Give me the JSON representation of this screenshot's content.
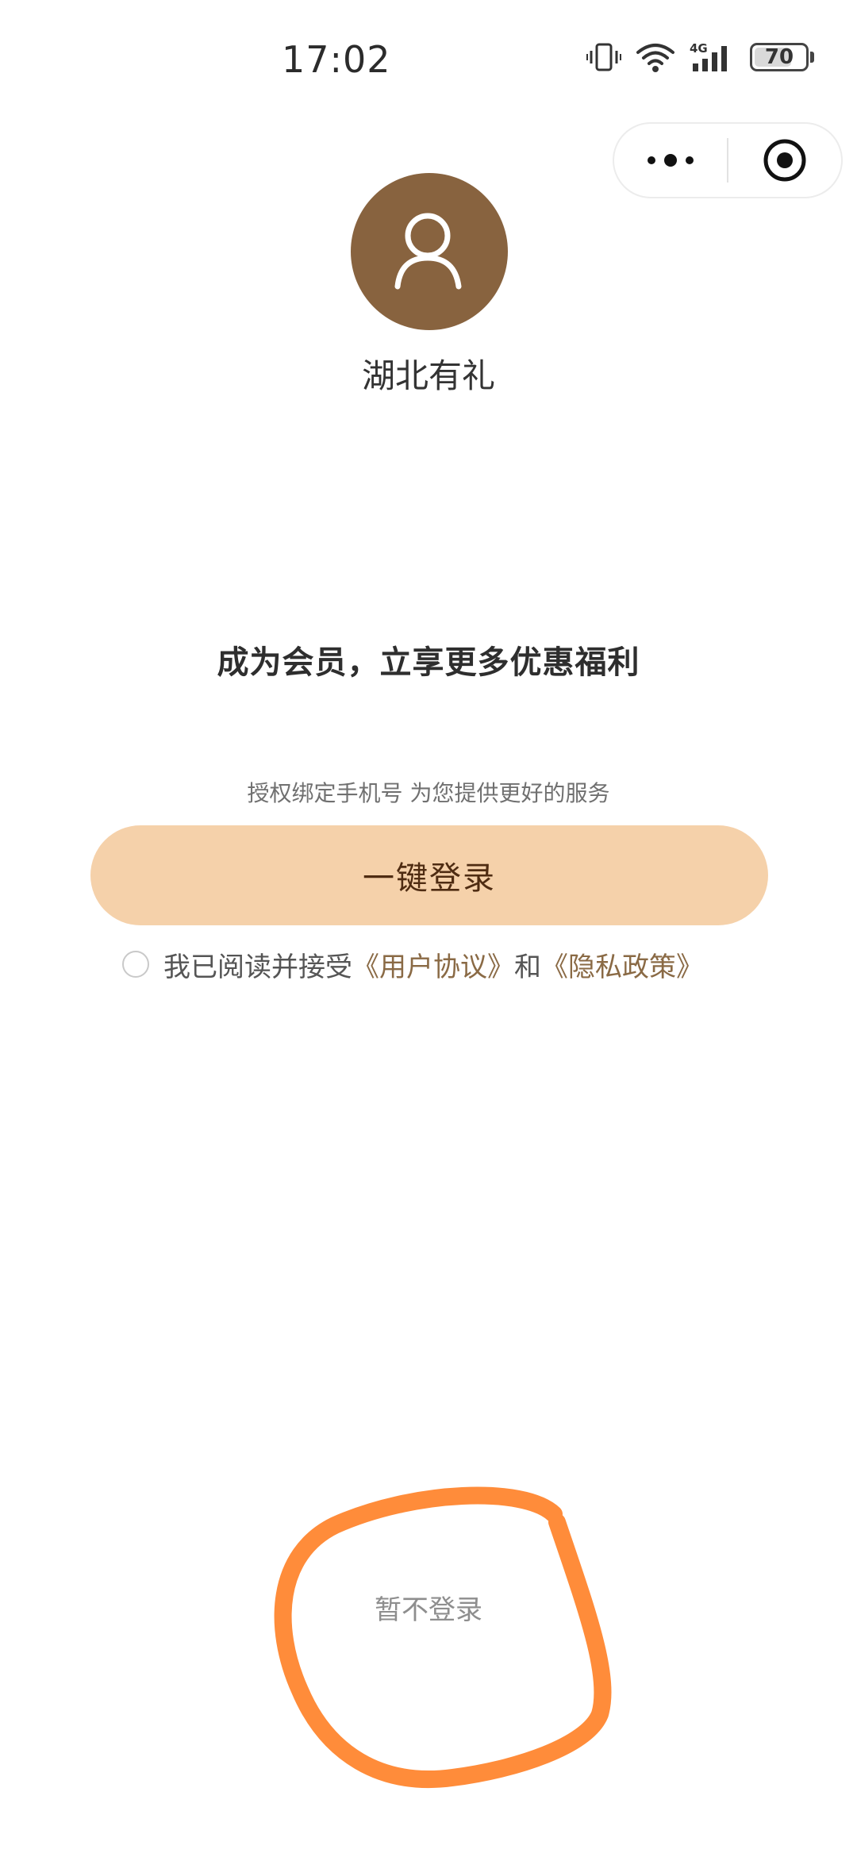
{
  "status_bar": {
    "time": "17:02",
    "network": "4G",
    "battery_level": "70",
    "icons": [
      "vibrate-icon",
      "wifi-icon",
      "signal-4g-icon",
      "battery-icon"
    ]
  },
  "capsule": {
    "icons": [
      "more-icon",
      "close-miniprogram-icon"
    ]
  },
  "app": {
    "name": "湖北有礼",
    "avatar_icon": "user-avatar-icon"
  },
  "login": {
    "headline": "成为会员，立享更多优惠福利",
    "subtext": "授权绑定手机号 为您提供更好的服务",
    "button_label": "一键登录",
    "agreement_prefix": "我已阅读并接受",
    "user_agreement": "《用户协议》",
    "and_text": "和",
    "privacy_policy": "《隐私政策》",
    "skip_label": "暂不登录"
  },
  "colors": {
    "avatar_bg": "#88633f",
    "button_bg": "#f5d1aa",
    "button_text": "#4f2c12",
    "link": "#8a6a45",
    "annotation": "#ff8c3a"
  }
}
